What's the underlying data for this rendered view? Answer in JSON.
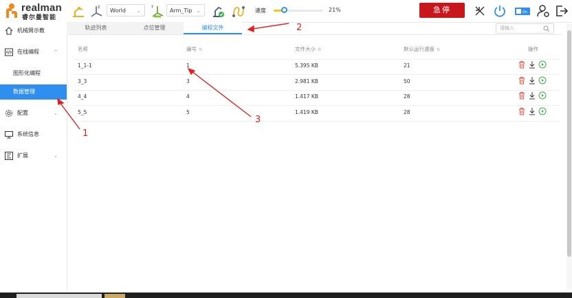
{
  "brand": {
    "name": "realman",
    "subtitle": "睿尔曼智能"
  },
  "header": {
    "coord_select": "World",
    "tool_select": "Arm_Tip",
    "speed_label": "速度",
    "speed_value": "21%",
    "speed_fraction": 0.21,
    "estop_label": "急停"
  },
  "sidebar": {
    "items": [
      {
        "label": "机械臂示教"
      },
      {
        "label": "在线编程"
      },
      {
        "label": "图形化编程"
      },
      {
        "label": "数据管理"
      },
      {
        "label": "配置"
      },
      {
        "label": "系统信息"
      },
      {
        "label": "扩展"
      }
    ]
  },
  "tabs": [
    {
      "label": "轨迹列表"
    },
    {
      "label": "点位管理"
    },
    {
      "label": "编程文件"
    }
  ],
  "search": {
    "placeholder": "请输入"
  },
  "table": {
    "headers": [
      "名称",
      "编号",
      "文件大小",
      "默认运行速度",
      "操作"
    ],
    "rows": [
      [
        "1_1-1",
        "1",
        "5.395 KB",
        "21"
      ],
      [
        "3_3",
        "3",
        "2.981 KB",
        "50"
      ],
      [
        "4_4",
        "4",
        "1.417 KB",
        "28"
      ],
      [
        "5_5",
        "5",
        "1.419 KB",
        "28"
      ]
    ]
  },
  "annotations": {
    "a1": "1",
    "a2": "2",
    "a3": "3"
  },
  "colors": {
    "accent": "#2e8ff0",
    "estop": "#c8161d",
    "annotation": "#e02020",
    "slider_fill": "#f5c518"
  }
}
